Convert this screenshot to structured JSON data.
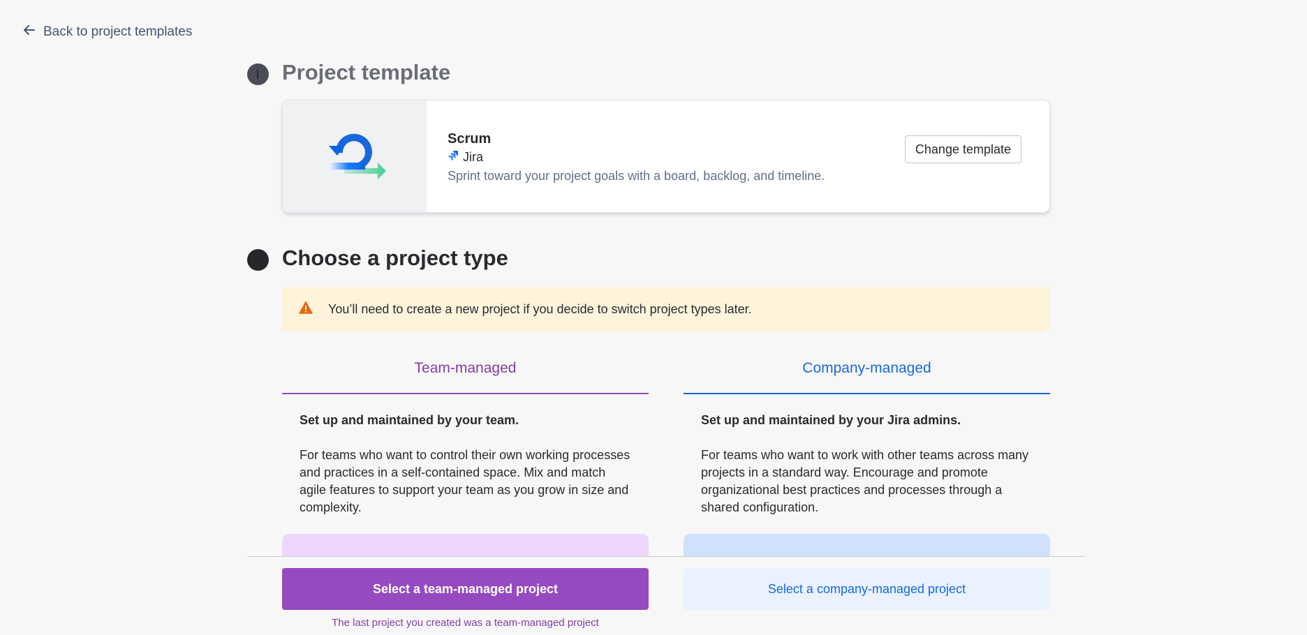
{
  "back_link": {
    "label": "Back to project templates",
    "icon": "arrow-left-icon"
  },
  "step1": {
    "title": "Project template",
    "template": {
      "name": "Scrum",
      "product": "Jira",
      "description": "Sprint toward your project goals with a board, backlog, and timeline.",
      "change_label": "Change template"
    }
  },
  "step2": {
    "title": "Choose a project type",
    "warning": "You’ll need to create a new project if you decide to switch project types later.",
    "team": {
      "tab": "Team-managed",
      "lead": "Set up and maintained by your team.",
      "body": "For teams who want to control their own working processes and practices in a self-contained space. Mix and match agile features to support your team as you grow in size and complexity."
    },
    "company": {
      "tab": "Company-managed",
      "lead": "Set up and maintained by your Jira admins.",
      "body": "For teams who want to work with other teams across many projects in a standard way. Encourage and promote organizational best practices and processes through a shared configuration."
    }
  },
  "footer": {
    "team_button": "Select a team-managed project",
    "company_button": "Select a company-managed project",
    "note": "The last project you created was a team-managed project"
  },
  "colors": {
    "team_accent": "#964ac0",
    "company_accent": "#1868db",
    "warning_bg": "#fff4db"
  }
}
